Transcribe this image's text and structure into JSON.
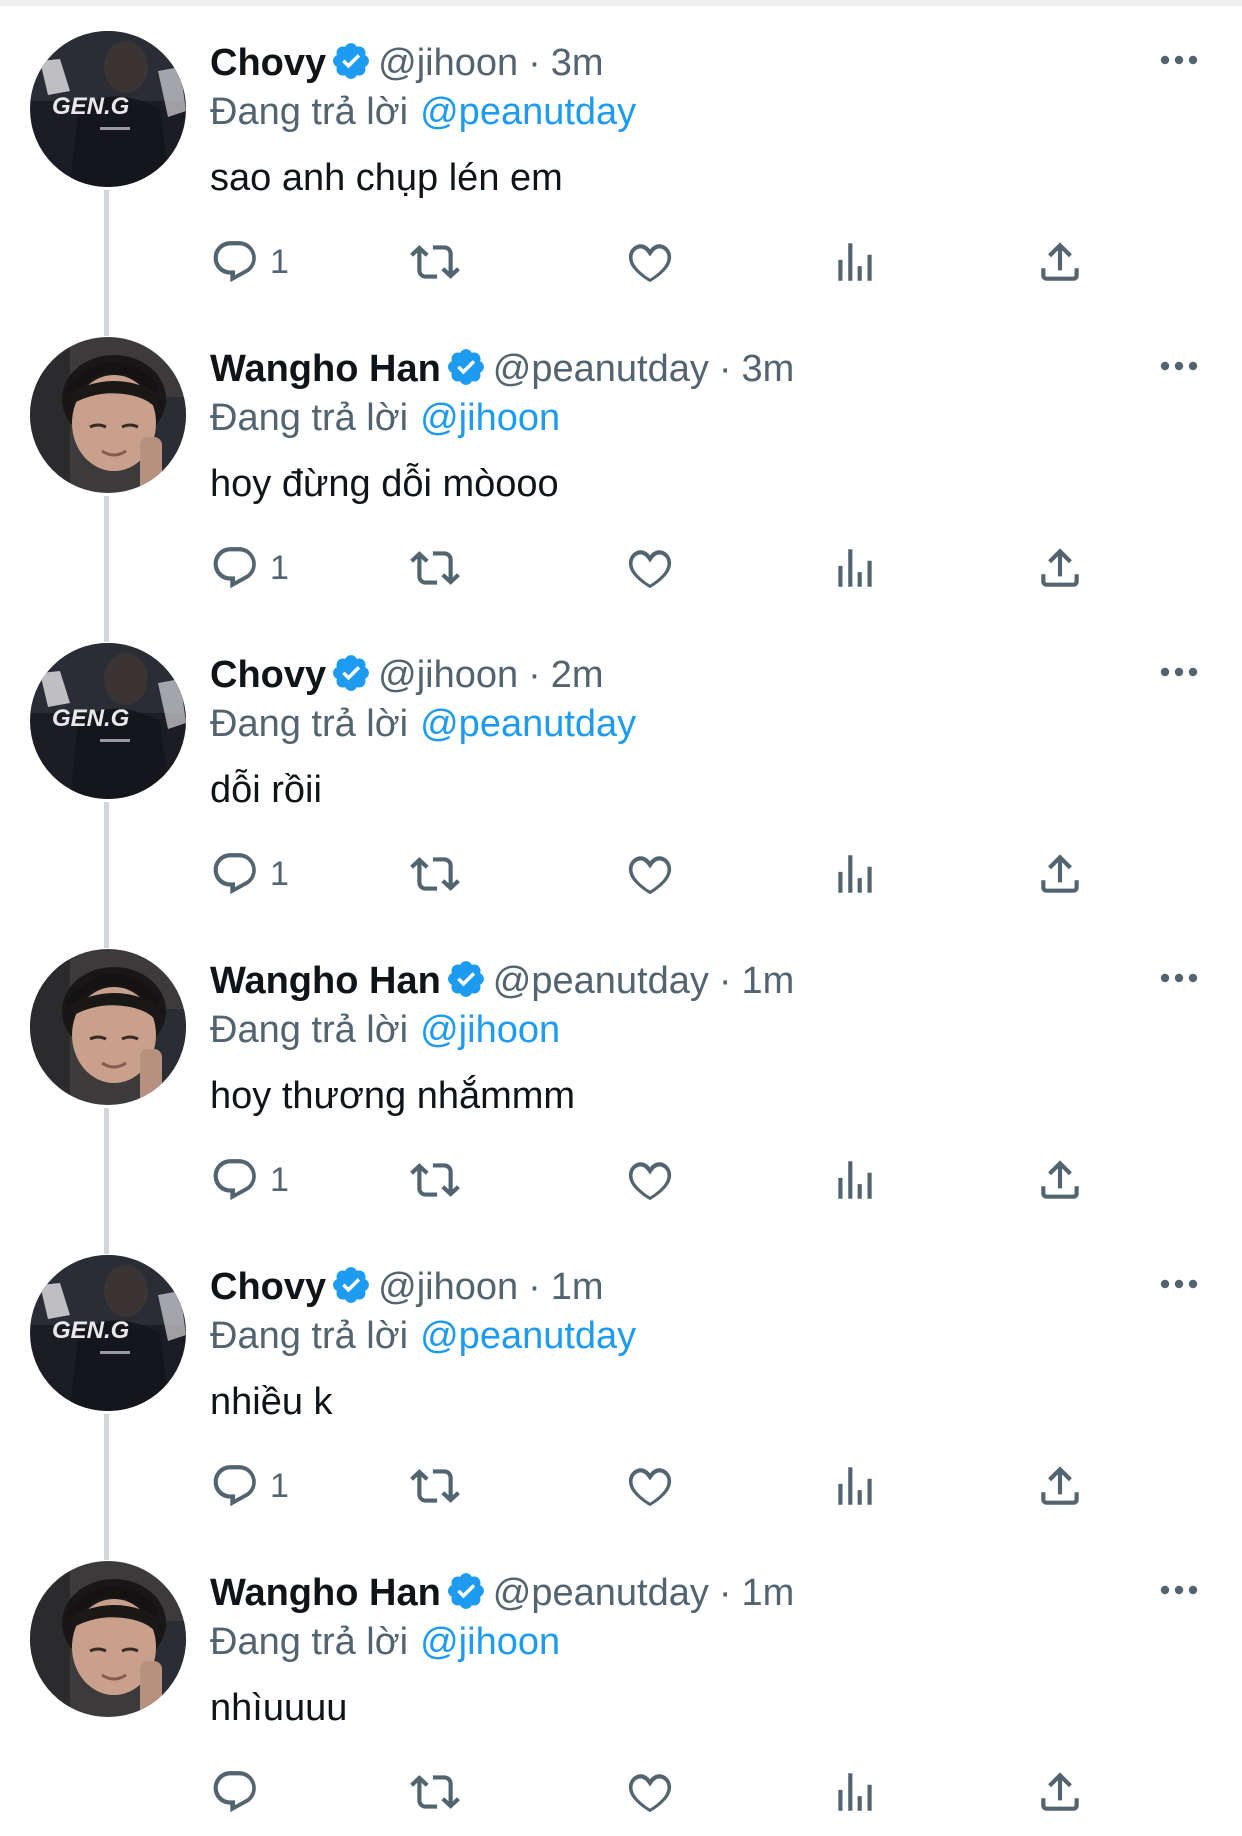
{
  "reply_prefix": "Đang trả lời",
  "colors": {
    "link": "#1d9bf0",
    "secondary": "#536471",
    "verified": "#1d9bf0",
    "text": "#0f1419"
  },
  "tweets": [
    {
      "name": "Chovy",
      "handle": "@jihoon",
      "time": "3m",
      "reply_to": "@peanutday",
      "text": "sao anh chụp lén em",
      "reply_count": "1",
      "avatar": "chovy"
    },
    {
      "name": "Wangho Han",
      "handle": "@peanutday",
      "time": "3m",
      "reply_to": "@jihoon",
      "text": "hoy đừng dỗi mòooo",
      "reply_count": "1",
      "avatar": "wangho"
    },
    {
      "name": "Chovy",
      "handle": "@jihoon",
      "time": "2m",
      "reply_to": "@peanutday",
      "text": "dỗi rồii",
      "reply_count": "1",
      "avatar": "chovy"
    },
    {
      "name": "Wangho Han",
      "handle": "@peanutday",
      "time": "1m",
      "reply_to": "@jihoon",
      "text": "hoy thương nhắmmm",
      "reply_count": "1",
      "avatar": "wangho"
    },
    {
      "name": "Chovy",
      "handle": "@jihoon",
      "time": "1m",
      "reply_to": "@peanutday",
      "text": "nhiều k",
      "reply_count": "1",
      "avatar": "chovy"
    },
    {
      "name": "Wangho Han",
      "handle": "@peanutday",
      "time": "1m",
      "reply_to": "@jihoon",
      "text": "nhìuuuu",
      "reply_count": "",
      "avatar": "wangho"
    }
  ],
  "avatar_logo_text": {
    "chovy": "GEN.G"
  },
  "icons": [
    "reply-icon",
    "retweet-icon",
    "like-icon",
    "views-icon",
    "share-icon",
    "more-icon",
    "verified-badge-icon"
  ]
}
